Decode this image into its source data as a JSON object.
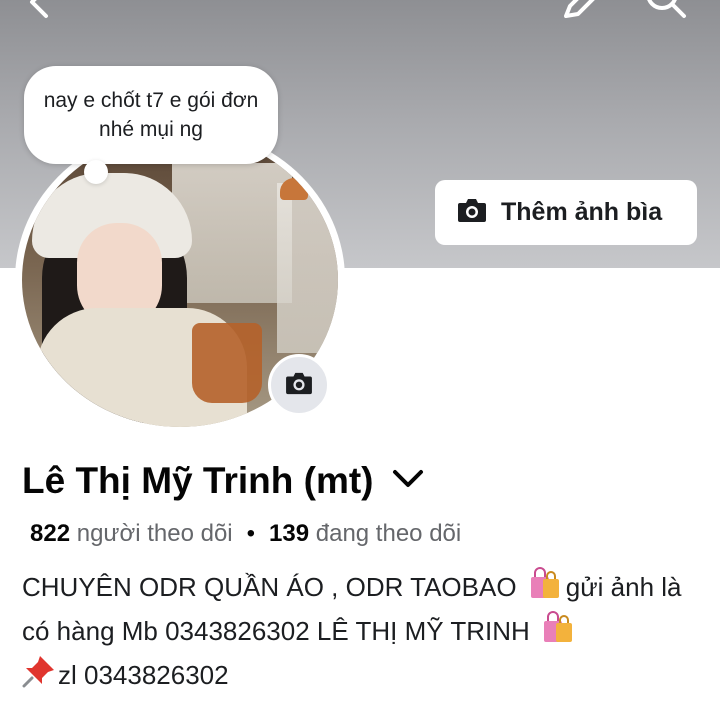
{
  "header": {
    "icons": [
      "back-icon",
      "edit-icon",
      "search-icon"
    ],
    "add_cover_label": "Thêm ảnh bìa"
  },
  "profile": {
    "note": "nay e chốt t7 e gói đơn nhé mụi ng",
    "name": "Lê Thị Mỹ Trinh (mt)",
    "followers_count": "822",
    "followers_label": "người theo dõi",
    "separator": "•",
    "following_count": "139",
    "following_label": "đang theo dõi"
  },
  "bio": {
    "line1_text": "CHUYÊN ODR QUẦN ÁO , ODR TAOBAO ",
    "line1_after_bag": "gửi ảnh là có hàng Mb 0343826302 LÊ THỊ MỸ TRINH",
    "line2_text": "zl 0343826302"
  },
  "colors": {
    "cover_top": "#8e8f93",
    "cover_bottom": "#c6c7ca",
    "secondary_text": "#65676b",
    "primary_text": "#050505",
    "button_gray": "#e4e6eb"
  }
}
